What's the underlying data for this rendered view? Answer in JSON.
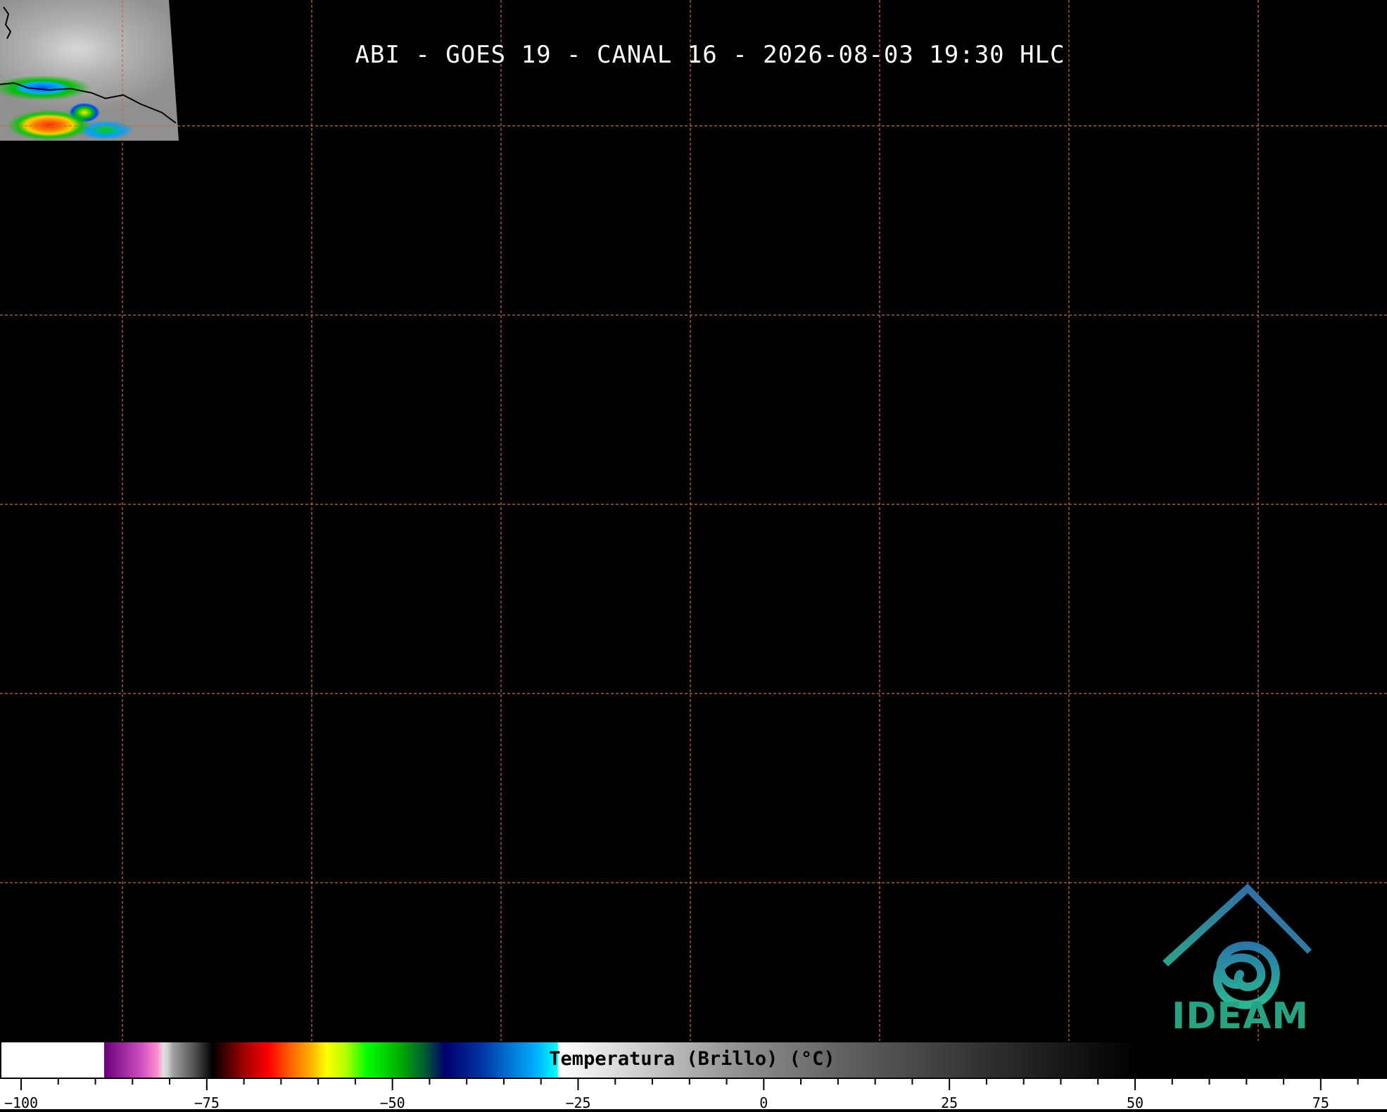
{
  "title": "ABI - GOES 19 - CANAL 16 - 2026-08-03 19:30 HLC",
  "logo": {
    "text": "IDEAM",
    "color": "#27a382"
  },
  "graticule": {
    "line_color": "#c0703a",
    "style": "dashed"
  },
  "colorbar": {
    "label": "Temperatura (Brillo) (°C)",
    "range": [
      -103,
      83
    ],
    "ticks": [
      {
        "value": -100,
        "label": "−100"
      },
      {
        "value": -75,
        "label": "−75"
      },
      {
        "value": -50,
        "label": "−50"
      },
      {
        "value": -25,
        "label": "−25"
      },
      {
        "value": 0,
        "label": "0"
      },
      {
        "value": 25,
        "label": "25"
      },
      {
        "value": 50,
        "label": "50"
      },
      {
        "value": 75,
        "label": "75"
      }
    ],
    "minor_tick_step": 5
  }
}
